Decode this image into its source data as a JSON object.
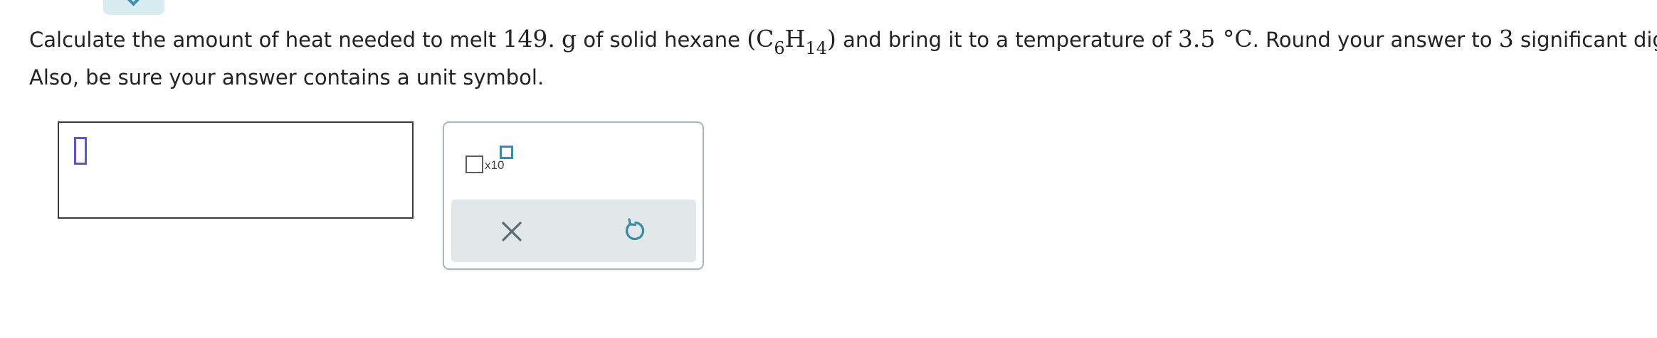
{
  "question": {
    "text_1": "Calculate the amount of heat needed to melt ",
    "mass_value": "149.",
    "mass_unit": "g",
    "text_2": " of solid hexane ",
    "formula_open": "(C",
    "formula_sub_1": "6",
    "formula_mid": "H",
    "formula_sub_2": "14",
    "formula_close": ")",
    "text_3": " and bring it to a temperature of ",
    "temperature": "3.5 °C",
    "text_4": ". Round your answer to ",
    "sig_figs": "3",
    "text_5": " significant digits.",
    "line_2": "Also, be sure your answer contains a unit symbol."
  },
  "answer": {
    "value": ""
  },
  "palette": {
    "x10_label": "x10",
    "clear_icon": "close-icon",
    "reset_icon": "undo-icon"
  },
  "colors": {
    "accent": "#3a8aa8",
    "cursor": "#5a55cc",
    "action_bar": "#e2e7ea",
    "top_tab": "#d9ecf2"
  }
}
